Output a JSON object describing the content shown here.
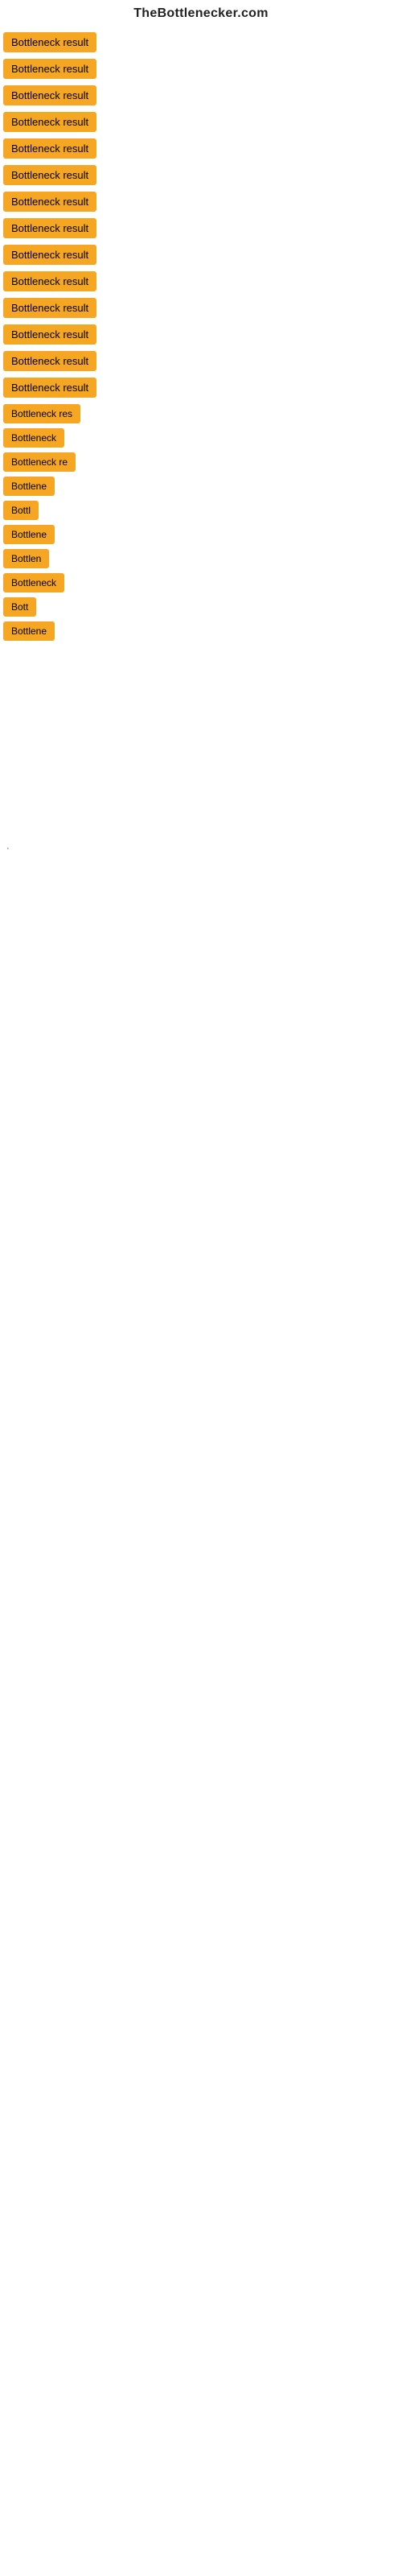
{
  "header": {
    "title": "TheBottlenecker.com"
  },
  "items": [
    {
      "id": 1,
      "label": "Bottleneck result",
      "width": 140,
      "gap": "large"
    },
    {
      "id": 2,
      "label": "Bottleneck result",
      "width": 140,
      "gap": "large"
    },
    {
      "id": 3,
      "label": "Bottleneck result",
      "width": 140,
      "gap": "large"
    },
    {
      "id": 4,
      "label": "Bottleneck result",
      "width": 140,
      "gap": "large"
    },
    {
      "id": 5,
      "label": "Bottleneck result",
      "width": 140,
      "gap": "large"
    },
    {
      "id": 6,
      "label": "Bottleneck result",
      "width": 140,
      "gap": "large"
    },
    {
      "id": 7,
      "label": "Bottleneck result",
      "width": 140,
      "gap": "large"
    },
    {
      "id": 8,
      "label": "Bottleneck result",
      "width": 140,
      "gap": "large"
    },
    {
      "id": 9,
      "label": "Bottleneck result",
      "width": 140,
      "gap": "large"
    },
    {
      "id": 10,
      "label": "Bottleneck result",
      "width": 140,
      "gap": "large"
    },
    {
      "id": 11,
      "label": "Bottleneck result",
      "width": 140,
      "gap": "large"
    },
    {
      "id": 12,
      "label": "Bottleneck result",
      "width": 140,
      "gap": "large"
    },
    {
      "id": 13,
      "label": "Bottleneck result",
      "width": 140,
      "gap": "large"
    },
    {
      "id": 14,
      "label": "Bottleneck result",
      "width": 140,
      "gap": "large"
    },
    {
      "id": 15,
      "label": "Bottleneck res",
      "width": 120,
      "gap": "medium"
    },
    {
      "id": 16,
      "label": "Bottleneck",
      "width": 90,
      "gap": "medium"
    },
    {
      "id": 17,
      "label": "Bottleneck re",
      "width": 105,
      "gap": "medium"
    },
    {
      "id": 18,
      "label": "Bottlene",
      "width": 80,
      "gap": "medium"
    },
    {
      "id": 19,
      "label": "Bottl",
      "width": 55,
      "gap": "medium"
    },
    {
      "id": 20,
      "label": "Bottlene",
      "width": 80,
      "gap": "medium"
    },
    {
      "id": 21,
      "label": "Bottlen",
      "width": 75,
      "gap": "medium"
    },
    {
      "id": 22,
      "label": "Bottleneck",
      "width": 90,
      "gap": "medium"
    },
    {
      "id": 23,
      "label": "Bott",
      "width": 50,
      "gap": "medium"
    },
    {
      "id": 24,
      "label": "Bottlene",
      "width": 80,
      "gap": "medium"
    }
  ],
  "footer": {
    "dot_label": "·"
  },
  "colors": {
    "badge_bg": "#f5a623",
    "badge_text": "#000000",
    "header_text": "#222222"
  }
}
